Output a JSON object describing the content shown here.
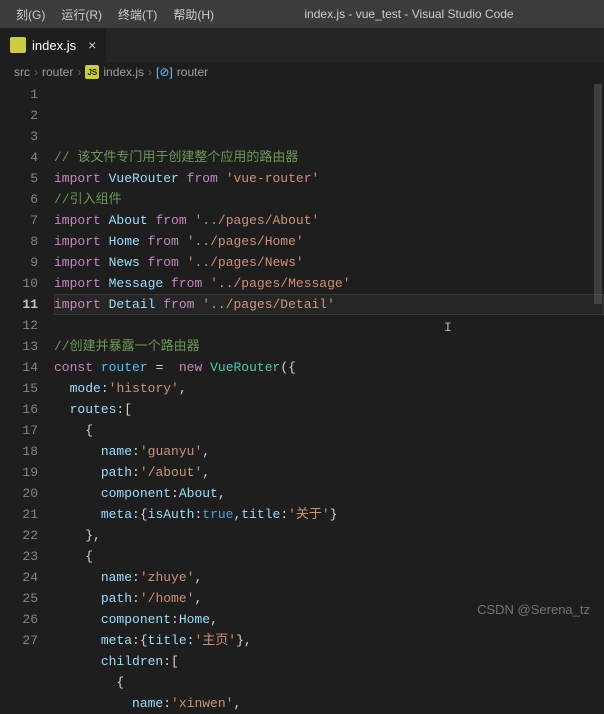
{
  "menubar": {
    "items": [
      "刻(G)",
      "运行(R)",
      "终端(T)",
      "帮助(H)"
    ]
  },
  "title": "index.js - vue_test - Visual Studio Code",
  "tabs": [
    {
      "icon": "JS",
      "label": "index.js",
      "active": true
    }
  ],
  "breadcrumbs": {
    "parts": [
      "src",
      "router",
      "index.js",
      "router"
    ],
    "icon_file": "JS",
    "icon_symbol": "[⊘]"
  },
  "editor": {
    "current_line": 11,
    "lines": [
      {
        "n": 1,
        "tokens": [
          [
            "c-comment",
            "// 该文件专门用于创建整个应用的路由器"
          ]
        ]
      },
      {
        "n": 2,
        "tokens": [
          [
            "c-keyword",
            "import"
          ],
          [
            "",
            " "
          ],
          [
            "c-var",
            "VueRouter"
          ],
          [
            "",
            " "
          ],
          [
            "c-keyword",
            "from"
          ],
          [
            "",
            " "
          ],
          [
            "c-string",
            "'vue-router'"
          ]
        ]
      },
      {
        "n": 3,
        "tokens": [
          [
            "c-comment",
            "//引入组件"
          ]
        ]
      },
      {
        "n": 4,
        "tokens": [
          [
            "c-keyword",
            "import"
          ],
          [
            "",
            " "
          ],
          [
            "c-var",
            "About"
          ],
          [
            "",
            " "
          ],
          [
            "c-keyword",
            "from"
          ],
          [
            "",
            " "
          ],
          [
            "c-string",
            "'../pages/About'"
          ]
        ]
      },
      {
        "n": 5,
        "tokens": [
          [
            "c-keyword",
            "import"
          ],
          [
            "",
            " "
          ],
          [
            "c-var",
            "Home"
          ],
          [
            "",
            " "
          ],
          [
            "c-keyword",
            "from"
          ],
          [
            "",
            " "
          ],
          [
            "c-string",
            "'../pages/Home'"
          ]
        ]
      },
      {
        "n": 6,
        "tokens": [
          [
            "c-keyword",
            "import"
          ],
          [
            "",
            " "
          ],
          [
            "c-var",
            "News"
          ],
          [
            "",
            " "
          ],
          [
            "c-keyword",
            "from"
          ],
          [
            "",
            " "
          ],
          [
            "c-string",
            "'../pages/News'"
          ]
        ]
      },
      {
        "n": 7,
        "tokens": [
          [
            "c-keyword",
            "import"
          ],
          [
            "",
            " "
          ],
          [
            "c-var",
            "Message"
          ],
          [
            "",
            " "
          ],
          [
            "c-keyword",
            "from"
          ],
          [
            "",
            " "
          ],
          [
            "c-string",
            "'../pages/Message'"
          ]
        ]
      },
      {
        "n": 8,
        "tokens": [
          [
            "c-keyword",
            "import"
          ],
          [
            "",
            " "
          ],
          [
            "c-var",
            "Detail"
          ],
          [
            "",
            " "
          ],
          [
            "c-keyword",
            "from"
          ],
          [
            "",
            " "
          ],
          [
            "c-string",
            "'../pages/Detail'"
          ]
        ]
      },
      {
        "n": 9,
        "tokens": [
          [
            "",
            ""
          ]
        ]
      },
      {
        "n": 10,
        "tokens": [
          [
            "c-comment",
            "//创建并暴露一个路由器"
          ]
        ]
      },
      {
        "n": 11,
        "tokens": [
          [
            "c-keyword",
            "const"
          ],
          [
            "",
            " "
          ],
          [
            "c-type",
            "router"
          ],
          [
            "",
            " "
          ],
          [
            "c-punc",
            "="
          ],
          [
            "",
            "  "
          ],
          [
            "c-keyword",
            "new"
          ],
          [
            "",
            " "
          ],
          [
            "c-class",
            "VueRouter"
          ],
          [
            "c-punc",
            "({"
          ]
        ]
      },
      {
        "n": 12,
        "tokens": [
          [
            "",
            "  "
          ],
          [
            "c-prop",
            "mode"
          ],
          [
            "c-punc",
            ":"
          ],
          [
            "c-string",
            "'history'"
          ],
          [
            "c-punc",
            ","
          ]
        ]
      },
      {
        "n": 13,
        "tokens": [
          [
            "",
            "  "
          ],
          [
            "c-prop",
            "routes"
          ],
          [
            "c-punc",
            ":["
          ]
        ]
      },
      {
        "n": 14,
        "tokens": [
          [
            "",
            "    "
          ],
          [
            "c-punc",
            "{"
          ]
        ]
      },
      {
        "n": 15,
        "tokens": [
          [
            "",
            "      "
          ],
          [
            "c-prop",
            "name"
          ],
          [
            "c-punc",
            ":"
          ],
          [
            "c-string",
            "'guanyu'"
          ],
          [
            "c-punc",
            ","
          ]
        ]
      },
      {
        "n": 16,
        "tokens": [
          [
            "",
            "      "
          ],
          [
            "c-prop",
            "path"
          ],
          [
            "c-punc",
            ":"
          ],
          [
            "c-string",
            "'/about'"
          ],
          [
            "c-punc",
            ","
          ]
        ]
      },
      {
        "n": 17,
        "tokens": [
          [
            "",
            "      "
          ],
          [
            "c-prop",
            "component"
          ],
          [
            "c-punc",
            ":"
          ],
          [
            "c-var",
            "About"
          ],
          [
            "c-punc",
            ","
          ]
        ]
      },
      {
        "n": 18,
        "tokens": [
          [
            "",
            "      "
          ],
          [
            "c-prop",
            "meta"
          ],
          [
            "c-punc",
            ":{"
          ],
          [
            "c-prop",
            "isAuth"
          ],
          [
            "c-punc",
            ":"
          ],
          [
            "c-const",
            "true"
          ],
          [
            "c-punc",
            ","
          ],
          [
            "c-prop",
            "title"
          ],
          [
            "c-punc",
            ":"
          ],
          [
            "c-string",
            "'关于'"
          ],
          [
            "c-punc",
            "}"
          ]
        ]
      },
      {
        "n": 19,
        "tokens": [
          [
            "",
            "    "
          ],
          [
            "c-punc",
            "},"
          ]
        ]
      },
      {
        "n": 20,
        "tokens": [
          [
            "",
            "    "
          ],
          [
            "c-punc",
            "{"
          ]
        ]
      },
      {
        "n": 21,
        "tokens": [
          [
            "",
            "      "
          ],
          [
            "c-prop",
            "name"
          ],
          [
            "c-punc",
            ":"
          ],
          [
            "c-string",
            "'zhuye'"
          ],
          [
            "c-punc",
            ","
          ]
        ]
      },
      {
        "n": 22,
        "tokens": [
          [
            "",
            "      "
          ],
          [
            "c-prop",
            "path"
          ],
          [
            "c-punc",
            ":"
          ],
          [
            "c-string",
            "'/home'"
          ],
          [
            "c-punc",
            ","
          ]
        ]
      },
      {
        "n": 23,
        "tokens": [
          [
            "",
            "      "
          ],
          [
            "c-prop",
            "component"
          ],
          [
            "c-punc",
            ":"
          ],
          [
            "c-var",
            "Home"
          ],
          [
            "c-punc",
            ","
          ]
        ]
      },
      {
        "n": 24,
        "tokens": [
          [
            "",
            "      "
          ],
          [
            "c-prop",
            "meta"
          ],
          [
            "c-punc",
            ":{"
          ],
          [
            "c-prop",
            "title"
          ],
          [
            "c-punc",
            ":"
          ],
          [
            "c-string",
            "'主页'"
          ],
          [
            "c-punc",
            "},"
          ]
        ]
      },
      {
        "n": 25,
        "tokens": [
          [
            "",
            "      "
          ],
          [
            "c-prop",
            "children"
          ],
          [
            "c-punc",
            ":["
          ]
        ]
      },
      {
        "n": 26,
        "tokens": [
          [
            "",
            "        "
          ],
          [
            "c-punc",
            "{"
          ]
        ]
      },
      {
        "n": 27,
        "tokens": [
          [
            "",
            "          "
          ],
          [
            "c-prop",
            "name"
          ],
          [
            "c-punc",
            ":"
          ],
          [
            "c-string",
            "'xinwen'"
          ],
          [
            "c-punc",
            ","
          ]
        ]
      }
    ]
  },
  "cursor_text": "I",
  "watermark": "CSDN @Serena_tz"
}
